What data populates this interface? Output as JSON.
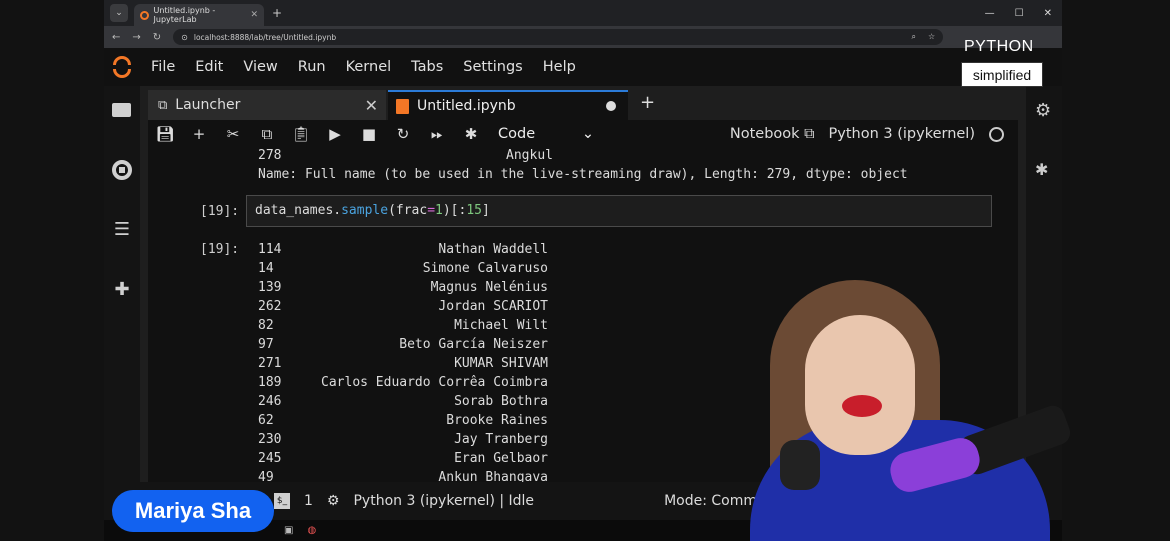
{
  "browser": {
    "tab_title": "Untitled.ipynb - JupyterLab",
    "url": "localhost:8888/lab/tree/Untitled.ipynb"
  },
  "menu": [
    "File",
    "Edit",
    "View",
    "Run",
    "Kernel",
    "Tabs",
    "Settings",
    "Help"
  ],
  "tabs": {
    "launcher": "Launcher",
    "notebook": "Untitled.ipynb"
  },
  "toolbar": {
    "cell_type": "Code",
    "notebook_label": "Notebook",
    "kernel": "Python 3 (ipykernel)"
  },
  "output_top": {
    "index": "278",
    "name": "Angkul",
    "meta": "Name: Full name (to be used in the live-streaming draw), Length: 279, dtype: object"
  },
  "cell": {
    "in_prompt": "[19]:",
    "out_prompt": "[19]:",
    "code_var": "data_names.",
    "code_method": "sample",
    "code_arg": "(frac",
    "code_eq": "=",
    "code_num": "1",
    "code_rest": ")[:",
    "code_num2": "15",
    "code_end": "]"
  },
  "rows": [
    {
      "i": "114",
      "n": "Nathan Waddell"
    },
    {
      "i": "14",
      "n": "Simone Calvaruso"
    },
    {
      "i": "139",
      "n": "Magnus Nelénius"
    },
    {
      "i": "262",
      "n": "Jordan SCARIOT"
    },
    {
      "i": "82",
      "n": "Michael Wilt"
    },
    {
      "i": "97",
      "n": "Beto García Neiszer"
    },
    {
      "i": "271",
      "n": "KUMAR SHIVAM"
    },
    {
      "i": "189",
      "n": "Carlos Eduardo Corrêa Coimbra"
    },
    {
      "i": "246",
      "n": "Sorab Bothra"
    },
    {
      "i": "62",
      "n": "Brooke Raines"
    },
    {
      "i": "230",
      "n": "Jay Tranberg"
    },
    {
      "i": "245",
      "n": "Eran Gelbaor"
    },
    {
      "i": "49",
      "n": "Ankun Bhangava"
    }
  ],
  "status": {
    "count": "1",
    "kernel_state": "Python 3 (ipykernel) | Idle",
    "mode": "Mode: Command"
  },
  "watermark": {
    "title": "PYTHON",
    "subtitle": "simplified"
  },
  "presenter_name": "Mariya Sha"
}
